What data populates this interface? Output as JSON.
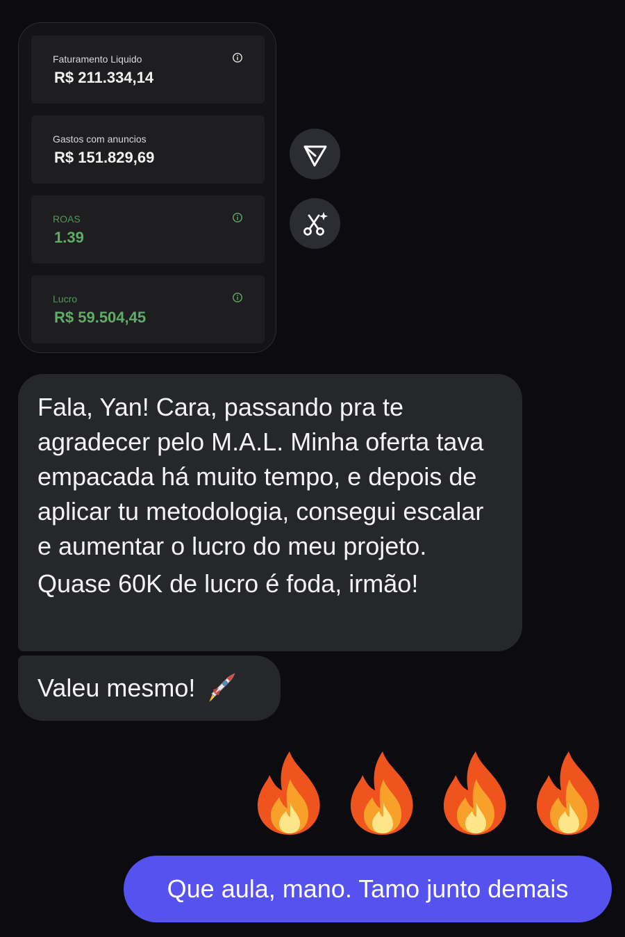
{
  "shared_card": {
    "metrics": [
      {
        "label": "Faturamento Liquido",
        "value": "R$ 211.334,14",
        "has_info": true,
        "highlight": false
      },
      {
        "label": "Gastos com anuncios",
        "value": "R$ 151.829,69",
        "has_info": false,
        "highlight": false
      },
      {
        "label": "ROAS",
        "value": "1.39",
        "has_info": true,
        "highlight": true
      },
      {
        "label": "Lucro",
        "value": "R$ 59.504,45",
        "has_info": true,
        "highlight": true
      }
    ]
  },
  "actions": {
    "share_icon": "send-icon",
    "magic_icon": "scissors-sparkle-icon"
  },
  "messages": {
    "received_main": {
      "lines": [
        "Fala, Yan! Cara, passando pra te agradecer pelo M.A.L. Minha oferta tava empacada há muito tempo, e depois de aplicar tu metodologia, consegui escalar e aumentar o lucro do meu projeto.",
        "Quase 60K de lucro é foda, irmão!"
      ]
    },
    "received_second": {
      "text": "Valeu mesmo!",
      "emoji": "rocket"
    },
    "reaction": {
      "emoji": "fire",
      "count": 4
    },
    "sent": {
      "text": "Que aula, mano. Tamo junto demais"
    }
  },
  "colors": {
    "background": "#0c0c10",
    "received_bubble": "#26272b",
    "sent_bubble": "#5552f0",
    "positive_green": "#5fae66"
  }
}
